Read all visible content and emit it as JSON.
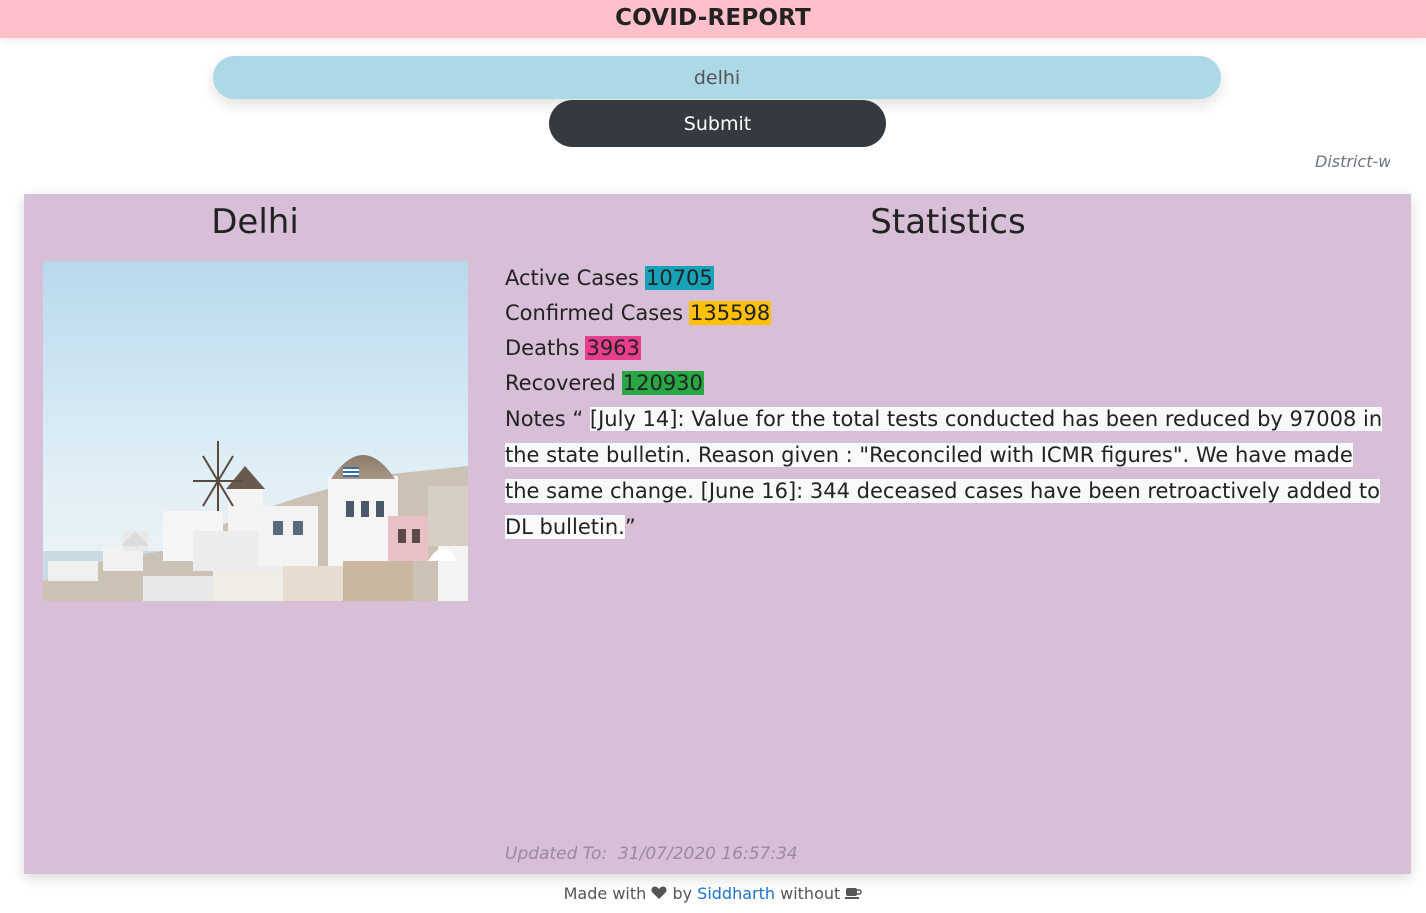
{
  "header": {
    "title": "COVID-REPORT"
  },
  "search": {
    "value": "delhi",
    "submit_label": "Submit"
  },
  "marquee": {
    "text": "District-wise"
  },
  "card": {
    "city": "Delhi",
    "stats_title": "Statistics",
    "stats": [
      {
        "label": "Active Cases",
        "value": "10705",
        "color": "#17a2b8"
      },
      {
        "label": "Confirmed Cases",
        "value": "135598",
        "color": "#ffc107"
      },
      {
        "label": "Deaths",
        "value": "3963",
        "color": "#e83e8c"
      },
      {
        "label": "Recovered",
        "value": "120930",
        "color": "#28a745"
      }
    ],
    "notes_label": "Notes “",
    "notes_text": "[July 14]: Value for the total tests conducted has been reduced by 97008 in the state bulletin. Reason given : \"Reconciled with ICMR figures\". We have made the same change. [June 16]: 344 deceased cases have been retroactively added to DL bulletin.",
    "notes_close": "”",
    "updated_label": "Updated To:",
    "updated_value": "31/07/2020 16:57:34"
  },
  "footer": {
    "made_with": "Made with",
    "by": "by",
    "author": "Siddharth",
    "without": "without",
    "heart_icon": "heart-icon",
    "coffee_icon": "coffee-icon"
  },
  "colors": {
    "header_bg": "#ffc0cb",
    "search_bg": "#add8e6",
    "button_bg": "#343a40",
    "card_bg": "#d8bfd8",
    "link": "#1a73c8"
  }
}
